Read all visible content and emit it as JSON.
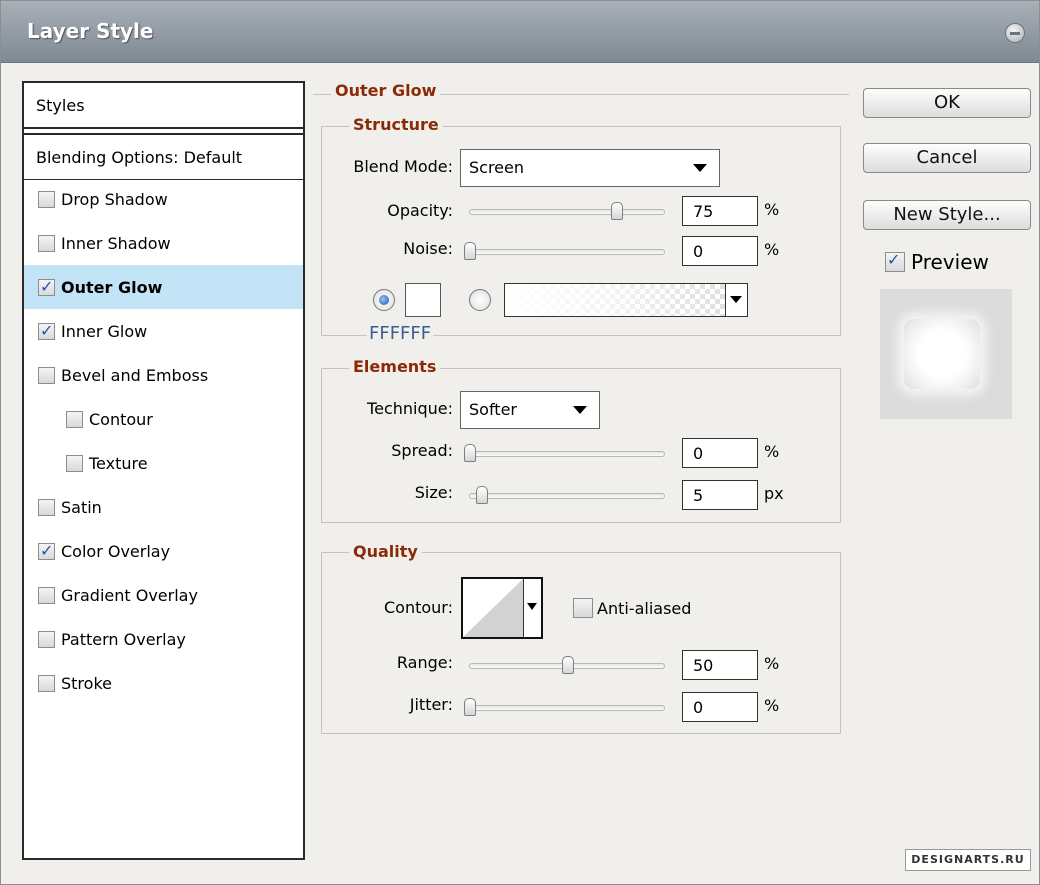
{
  "window": {
    "title": "Layer Style"
  },
  "styles_panel": {
    "header": "Styles",
    "blending": "Blending Options: Default",
    "items": [
      {
        "label": "Drop Shadow",
        "checked": false,
        "indent": false
      },
      {
        "label": "Inner Shadow",
        "checked": false,
        "indent": false
      },
      {
        "label": "Outer Glow",
        "checked": true,
        "indent": false,
        "selected": true
      },
      {
        "label": "Inner Glow",
        "checked": true,
        "indent": false
      },
      {
        "label": "Bevel and Emboss",
        "checked": false,
        "indent": false
      },
      {
        "label": "Contour",
        "checked": false,
        "indent": true
      },
      {
        "label": "Texture",
        "checked": false,
        "indent": true
      },
      {
        "label": "Satin",
        "checked": false,
        "indent": false
      },
      {
        "label": "Color Overlay",
        "checked": true,
        "indent": false
      },
      {
        "label": "Gradient Overlay",
        "checked": false,
        "indent": false
      },
      {
        "label": "Pattern Overlay",
        "checked": false,
        "indent": false
      },
      {
        "label": "Stroke",
        "checked": false,
        "indent": false
      }
    ]
  },
  "outer_glow": {
    "title": "Outer Glow",
    "structure": {
      "title": "Structure",
      "blend_mode_label": "Blend Mode:",
      "blend_mode": "Screen",
      "opacity_label": "Opacity:",
      "opacity": "75",
      "opacity_level": 0.75,
      "noise_label": "Noise:",
      "noise": "0",
      "noise_level": 0,
      "percent": "%",
      "color_hex": "FFFFFF",
      "color_mode": "solid"
    },
    "elements": {
      "title": "Elements",
      "technique_label": "Technique:",
      "technique": "Softer",
      "spread_label": "Spread:",
      "spread": "0",
      "spread_level": 0,
      "size_label": "Size:",
      "size": "5",
      "size_level": 0.02,
      "percent": "%",
      "px": "px"
    },
    "quality": {
      "title": "Quality",
      "contour_label": "Contour:",
      "anti_aliased_label": "Anti-aliased",
      "anti_aliased": false,
      "range_label": "Range:",
      "range": "50",
      "range_level": 0.5,
      "jitter_label": "Jitter:",
      "jitter": "0",
      "jitter_level": 0,
      "percent": "%"
    }
  },
  "buttons": {
    "ok": "OK",
    "cancel": "Cancel",
    "new_style": "New Style...",
    "preview_label": "Preview",
    "preview_checked": true
  },
  "watermark": "DESIGNARTS.RU",
  "colors": {
    "title_bar": "#8a939b",
    "group_label": "#8a2a06",
    "selected_row": "#c3e4f7",
    "hex_text": "#3a5f8f"
  }
}
